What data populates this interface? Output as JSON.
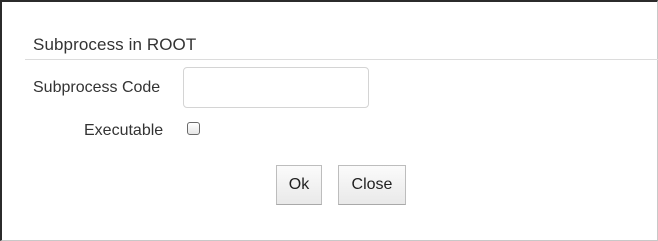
{
  "dialog": {
    "title": "Subprocess in ROOT"
  },
  "form": {
    "subprocess_code": {
      "label": "Subprocess Code",
      "value": ""
    },
    "executable": {
      "label": "Executable",
      "checked": false
    }
  },
  "buttons": {
    "ok_label": "Ok",
    "close_label": "Close"
  },
  "colors": {
    "text": "#333333",
    "border": "#d4d4d4",
    "background": "#ffffff"
  }
}
